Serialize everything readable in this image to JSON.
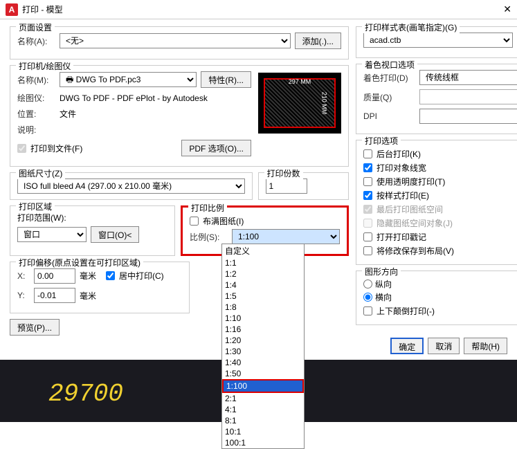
{
  "titlebar": {
    "title": "打印 - 模型"
  },
  "pageSetup": {
    "title": "页面设置",
    "nameLabel": "名称(A):",
    "nameValue": "<无>",
    "addBtn": "添加(.)..."
  },
  "printer": {
    "title": "打印机/绘图仪",
    "nameLabel": "名称(M):",
    "nameValue": "DWG To PDF.pc3",
    "propsBtn": "特性(R)...",
    "plotterLabel": "绘图仪:",
    "plotterValue": "DWG To PDF - PDF ePlot - by Autodesk",
    "locationLabel": "位置:",
    "locationValue": "文件",
    "descLabel": "说明:",
    "toFileLabel": "打印到文件(F)",
    "pdfOptBtn": "PDF 选项(O)...",
    "previewDimW": "297 MM",
    "previewDimH": "210 MM"
  },
  "paperSize": {
    "title": "图纸尺寸(Z)",
    "value": "ISO full bleed A4 (297.00 x 210.00 毫米)"
  },
  "copies": {
    "title": "打印份数",
    "value": "1"
  },
  "plotArea": {
    "title": "打印区域",
    "rangeLabel": "打印范围(W):",
    "rangeValue": "窗口",
    "windowBtn": "窗口(O)<"
  },
  "plotScale": {
    "title": "打印比例",
    "fitLabel": "布满图纸(I)",
    "scaleLabel": "比例(S):",
    "scaleValue": "1:100",
    "options": [
      "自定义",
      "1:1",
      "1:2",
      "1:4",
      "1:5",
      "1:8",
      "1:10",
      "1:16",
      "1:20",
      "1:30",
      "1:40",
      "1:50",
      "1:100",
      "2:1",
      "4:1",
      "8:1",
      "10:1",
      "100:1"
    ]
  },
  "offset": {
    "title": "打印偏移(原点设置在可打印区域)",
    "xLabel": "X:",
    "xValue": "0.00",
    "xUnit": "毫米",
    "yLabel": "Y:",
    "yValue": "-0.01",
    "yUnit": "毫米",
    "centerLabel": "居中打印(C)"
  },
  "styleTable": {
    "title": "打印样式表(画笔指定)(G)",
    "value": "acad.ctb"
  },
  "shadedViewport": {
    "title": "着色视口选项",
    "shadeLabel": "着色打印(D)",
    "shadeValue": "传统线框",
    "qualityLabel": "质量(Q)",
    "dpiLabel": "DPI"
  },
  "plotOptions": {
    "title": "打印选项",
    "bg": "后台打印(K)",
    "lw": "打印对象线宽",
    "trans": "使用透明度打印(T)",
    "styles": "按样式打印(E)",
    "paperLast": "最后打印图纸空间",
    "hidePaper": "隐藏图纸空间对象(J)",
    "stamp": "打开打印戳记",
    "saveLayout": "将修改保存到布局(V)"
  },
  "orientation": {
    "title": "图形方向",
    "portrait": "纵向",
    "landscape": "横向",
    "upside": "上下颠倒打印(-)"
  },
  "buttons": {
    "preview": "预览(P)...",
    "ok": "确定",
    "cancel": "取消",
    "help": "帮助(H)"
  },
  "bottomNumber": "29700"
}
